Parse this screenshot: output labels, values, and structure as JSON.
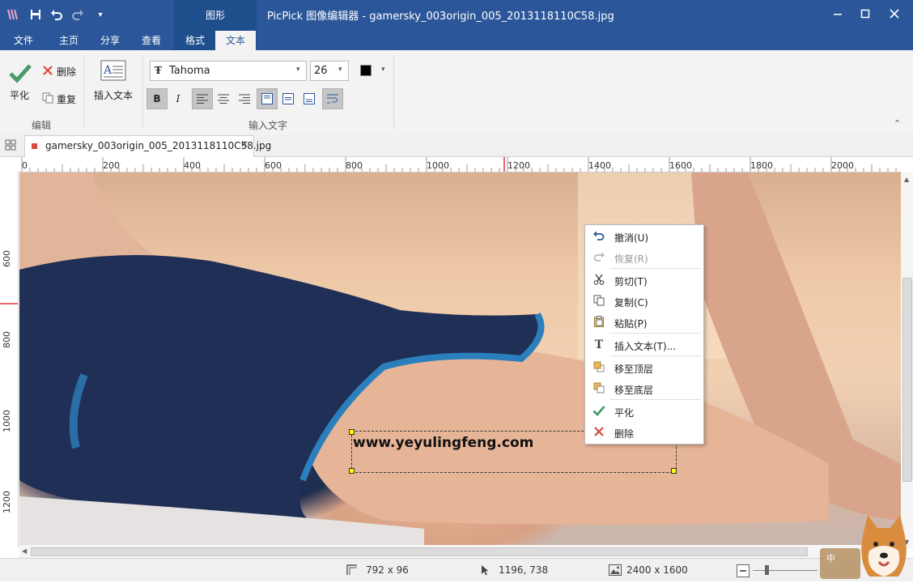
{
  "window": {
    "title": "PicPick 图像编辑器 - gamersky_003origin_005_2013118110C58.jpg",
    "context_group": "图形"
  },
  "ribbon_tabs": [
    "文件",
    "主页",
    "分享",
    "查看",
    "格式",
    "文本"
  ],
  "active_tab": "文本",
  "ribbon": {
    "edit_group": {
      "label": "编辑",
      "flatten": "平化",
      "delete": "删除",
      "repeat": "重复"
    },
    "insert_text": "插入文本",
    "text_group": {
      "label": "输入文字",
      "font": "Tahoma",
      "size": "26",
      "bold": "B",
      "italic": "I"
    }
  },
  "document_tab": "gamersky_003origin_005_2013118110C58.jpg",
  "ruler": {
    "h_labels": [
      "0",
      "200",
      "400",
      "600",
      "800",
      "1000",
      "1200",
      "1400",
      "1600",
      "1800",
      "2000"
    ],
    "v_labels": [
      "600",
      "800",
      "1000",
      "1200"
    ]
  },
  "canvas_text": "www.yeyulingfeng.com",
  "context_menu": [
    {
      "label": "撤消(U)",
      "icon": "undo-icon",
      "disabled": false
    },
    {
      "label": "恢复(R)",
      "icon": "redo-icon",
      "disabled": true
    },
    {
      "label": "剪切(T)",
      "icon": "scissors-icon",
      "disabled": false
    },
    {
      "label": "复制(C)",
      "icon": "copy-icon",
      "disabled": false
    },
    {
      "label": "粘贴(P)",
      "icon": "paste-icon",
      "disabled": false
    },
    {
      "label": "插入文本(T)...",
      "icon": "text-icon",
      "disabled": false
    },
    {
      "label": "移至顶层",
      "icon": "bring-front-icon",
      "disabled": false
    },
    {
      "label": "移至底层",
      "icon": "send-back-icon",
      "disabled": false
    },
    {
      "label": "平化",
      "icon": "check-icon",
      "disabled": false
    },
    {
      "label": "删除",
      "icon": "delete-icon",
      "disabled": false
    }
  ],
  "status": {
    "selection_size": "792 x 96",
    "cursor_pos": "1196, 738",
    "image_size": "2400 x 1600",
    "ime_label": "中"
  },
  "colors": {
    "accent": "#2b579a",
    "context_tab": "#1f4e8c",
    "check_green": "#4a9a6a",
    "delete_red": "#d9483b"
  }
}
